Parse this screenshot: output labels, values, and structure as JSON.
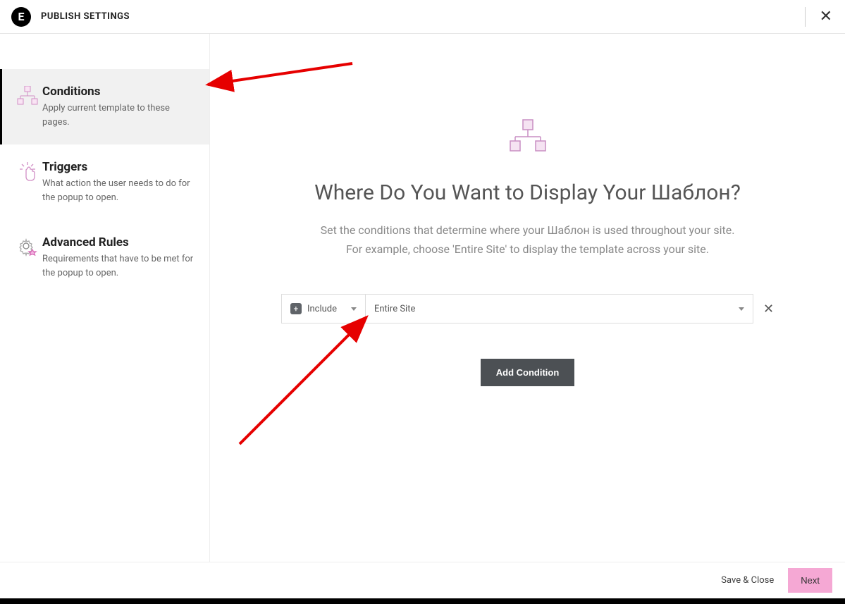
{
  "header": {
    "logo_text": "E",
    "title": "PUBLISH SETTINGS"
  },
  "sidebar": {
    "items": [
      {
        "title": "Conditions",
        "desc": "Apply current template to these pages.",
        "active": true
      },
      {
        "title": "Triggers",
        "desc": "What action the user needs to do for the popup to open."
      },
      {
        "title": "Advanced Rules",
        "desc": "Requirements that have to be met for the popup to open."
      }
    ]
  },
  "main": {
    "heading": "Where Do You Want to Display Your Шаблон?",
    "subtext": "Set the conditions that determine where your Шаблон is used throughout your site.\nFor example, choose 'Entire Site' to display the template across your site.",
    "condition": {
      "mode_label": "Include",
      "location_label": "Entire Site"
    },
    "add_button": "Add Condition"
  },
  "footer": {
    "save_close": "Save & Close",
    "next": "Next"
  }
}
